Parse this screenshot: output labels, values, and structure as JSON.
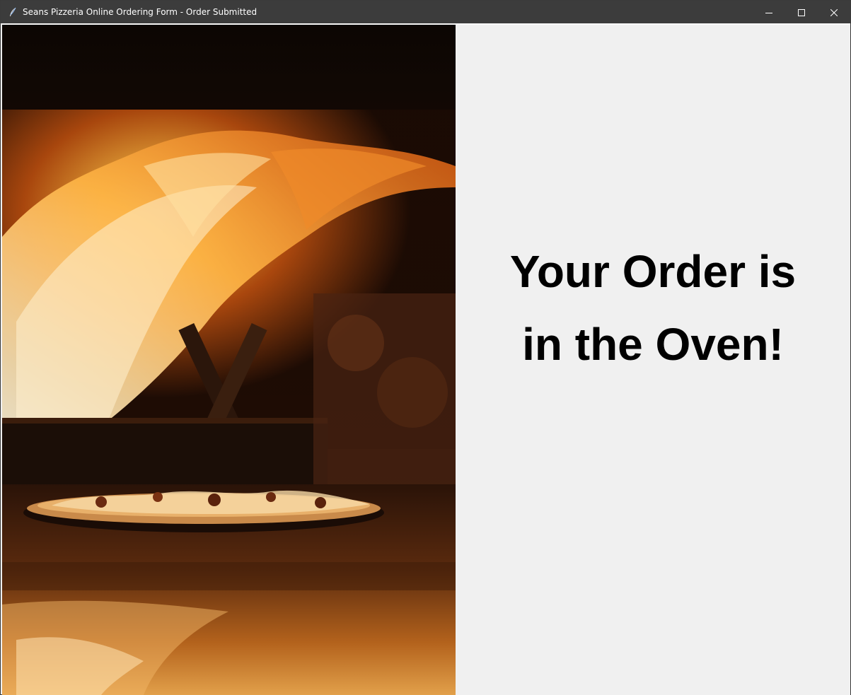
{
  "window": {
    "title": "Seans Pizzeria Online Ordering Form - Order Submitted",
    "app_icon": "feather-icon",
    "controls": {
      "minimize_icon": "minimize-icon",
      "maximize_icon": "maximize-icon",
      "close_icon": "close-icon"
    },
    "titlebar_color": "#3c3c3c"
  },
  "main": {
    "image": {
      "subject": "pizza-oven-flames-photo"
    },
    "message": {
      "line1": "Your Order is",
      "line2": "in the Oven!"
    },
    "background_color": "#f0f0f0"
  }
}
